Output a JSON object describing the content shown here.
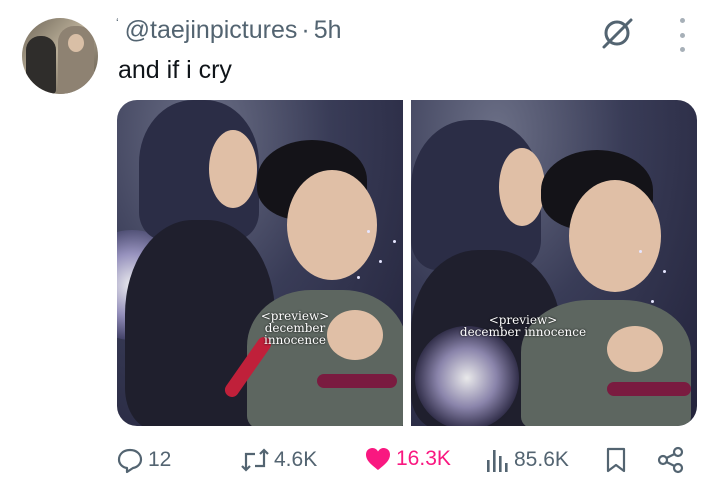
{
  "tweet": {
    "handle": "@taejinpictures",
    "separator": "·",
    "time": "5h",
    "leading_mark": "ʻ",
    "text": "and if i cry"
  },
  "media": [
    {
      "watermark_line1": "<preview>",
      "watermark_line2": "december innocence"
    },
    {
      "watermark_line1": "<preview>",
      "watermark_line2": "december innocence"
    }
  ],
  "actions": {
    "replies": "12",
    "reposts": "4.6K",
    "likes": "16.3K",
    "views": "85.6K"
  },
  "colors": {
    "like": "#f91880",
    "muted": "#536471",
    "text": "#0f1419"
  },
  "icons": [
    "grok-icon",
    "more-icon",
    "reply-icon",
    "repost-icon",
    "heart-icon",
    "views-icon",
    "bookmark-icon",
    "share-icon"
  ]
}
